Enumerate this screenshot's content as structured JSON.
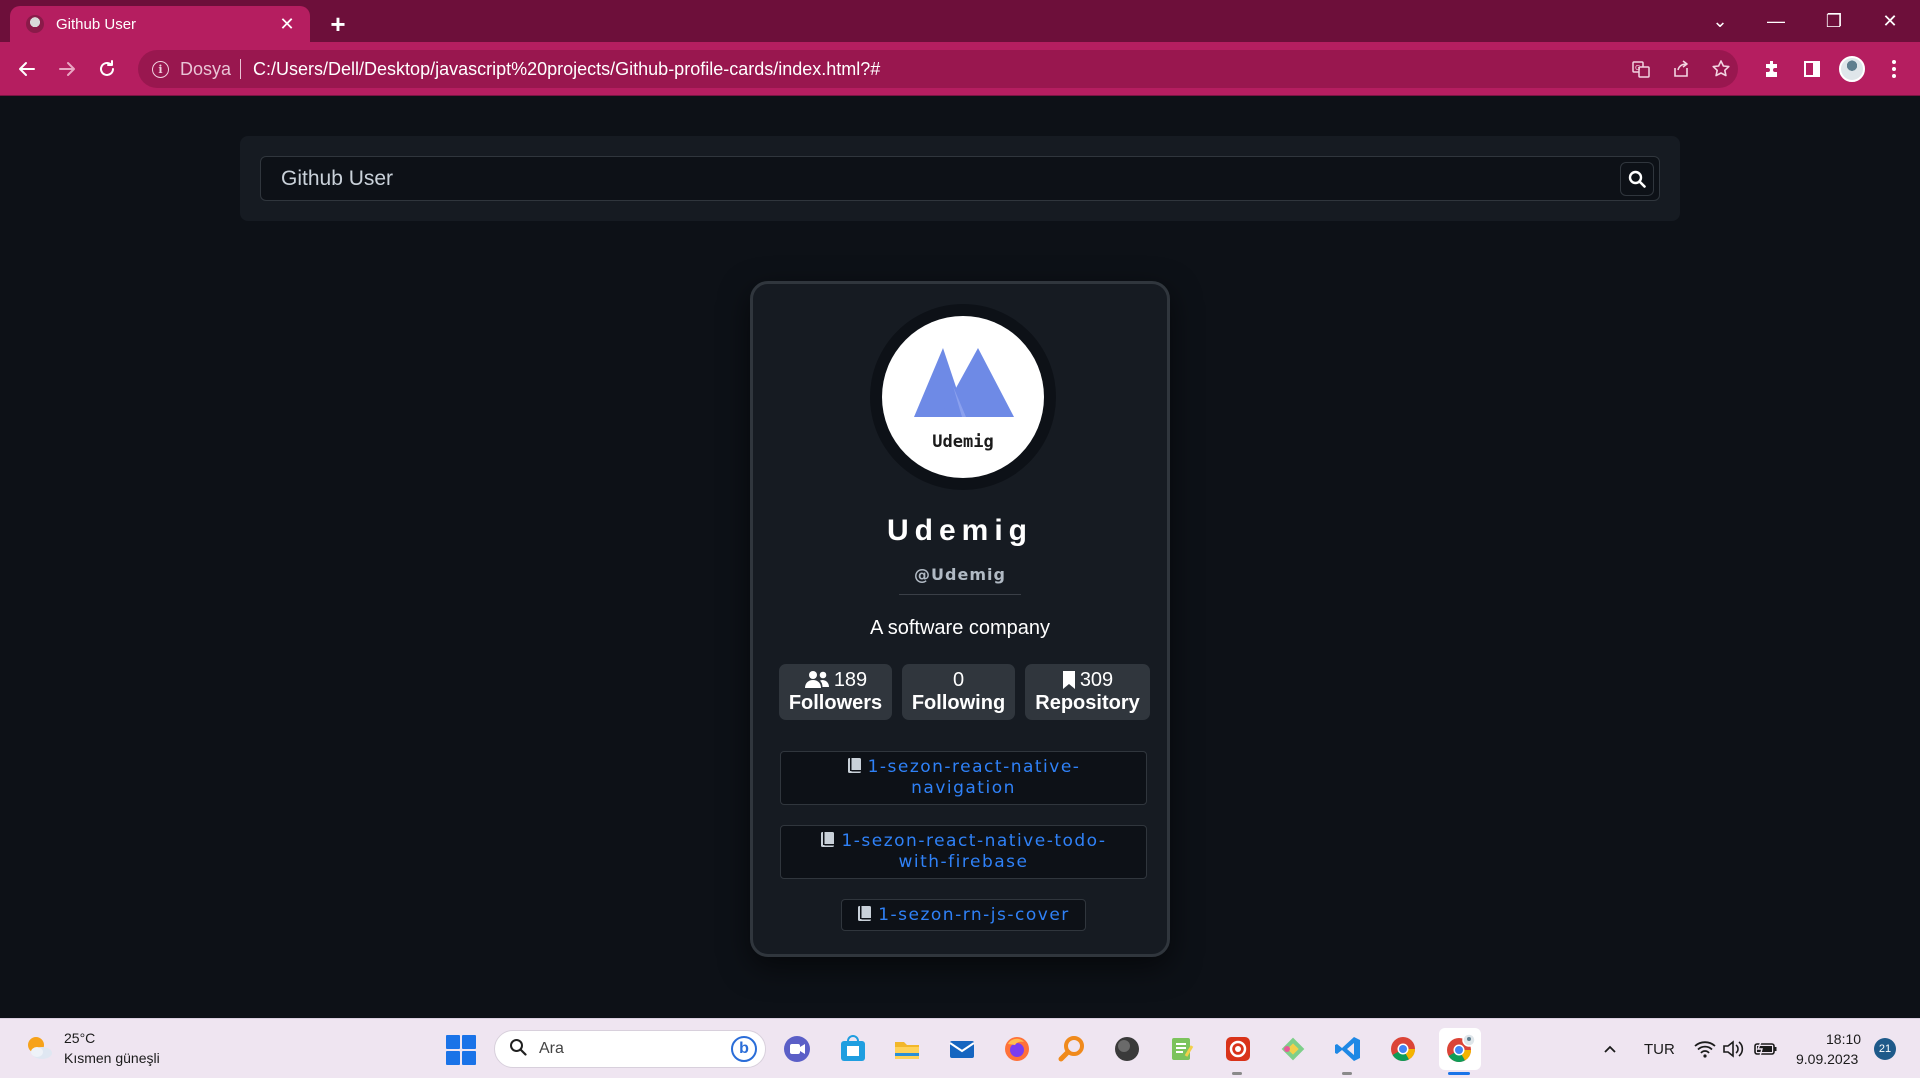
{
  "browser": {
    "tab_title": "Github User",
    "tab_close": "✕",
    "new_tab": "+",
    "window_controls": {
      "tab_search": "⌄",
      "minimize": "—",
      "restore": "❐",
      "close": "✕"
    },
    "origin_label": "Dosya",
    "url": "C:/Users/Dell/Desktop/javascript%20projects/Github-profile-cards/index.html?#",
    "theme_color": "#b51e60"
  },
  "search": {
    "placeholder": "Github User",
    "value": ""
  },
  "profile": {
    "avatar_text": "Udemig",
    "name": "Udemig",
    "login": "@Udemig",
    "bio": "A software company",
    "stats": [
      {
        "icon": "users-icon",
        "value": "189",
        "label": "Followers"
      },
      {
        "icon": "",
        "value": "0",
        "label": "Following"
      },
      {
        "icon": "bookmark-icon",
        "value": "309",
        "label": "Repository"
      }
    ],
    "repos": [
      {
        "name": "1-sezon-react-native-navigation",
        "line1": "1-sezon-react-native-",
        "line2": "navigation"
      },
      {
        "name": "1-sezon-react-native-todo-with-firebase",
        "line1": "1-sezon-react-native-todo-",
        "line2": "with-firebase"
      },
      {
        "name": "1-sezon-rn-js-cover",
        "line1": "1-sezon-rn-js-cover",
        "line2": ""
      }
    ],
    "colors": {
      "link": "#2f81f7",
      "card_bg": "#161b22",
      "page_bg": "#0d1117",
      "avatar_mark": "#6e8ae6"
    }
  },
  "taskbar": {
    "weather_temp": "25°C",
    "weather_desc": "Kısmen güneşli",
    "search_placeholder": "Ara",
    "language": "TUR",
    "time": "18:10",
    "date": "9.09.2023",
    "notifications": "21"
  }
}
